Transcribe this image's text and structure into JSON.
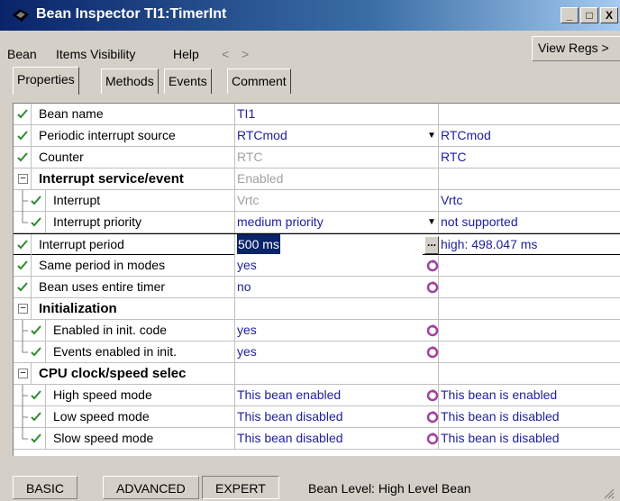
{
  "window": {
    "title": "Bean Inspector TI1:TimerInt",
    "minimize": "_",
    "maximize": "□",
    "close": "X"
  },
  "menu": {
    "items": [
      "Bean",
      "Items Visibility",
      "Help"
    ],
    "back": "<",
    "forward": ">",
    "view_regs": "View Regs >"
  },
  "tabs": [
    {
      "label": "Properties",
      "active": true
    },
    {
      "label": "Methods",
      "active": false
    },
    {
      "label": "Events",
      "active": false
    },
    {
      "label": "Comment",
      "active": false
    }
  ],
  "properties": [
    {
      "name": "Bean name",
      "value": "TI1",
      "info": ""
    },
    {
      "name": "Periodic interrupt source",
      "value": "RTCmod",
      "info": "RTCmod"
    },
    {
      "name": "Counter",
      "value": "RTC",
      "info": "RTC"
    },
    {
      "name": "Interrupt service/event",
      "value": "Enabled",
      "info": "",
      "expander": "−"
    },
    {
      "name": "Interrupt",
      "value": "Vrtc",
      "info": "Vrtc"
    },
    {
      "name": "Interrupt priority",
      "value": "medium priority",
      "info": "not supported"
    },
    {
      "name": "Interrupt period",
      "value": "500 ms",
      "info": "high: 498.047 ms",
      "ellipsis": "..."
    },
    {
      "name": "Same period in modes",
      "value": "yes",
      "info": ""
    },
    {
      "name": "Bean uses entire timer",
      "value": "no",
      "info": ""
    },
    {
      "name": "Initialization",
      "value": "",
      "info": "",
      "expander": "−"
    },
    {
      "name": "Enabled in init. code",
      "value": "yes",
      "info": ""
    },
    {
      "name": "Events enabled in init.",
      "value": "yes",
      "info": ""
    },
    {
      "name": "CPU clock/speed selec",
      "value": "",
      "info": "",
      "expander": "−"
    },
    {
      "name": "High speed mode",
      "value": "This bean enabled",
      "info": "This bean is enabled"
    },
    {
      "name": "Low speed mode",
      "value": "This bean disabled",
      "info": "This bean is disabled"
    },
    {
      "name": "Slow speed mode",
      "value": "This bean disabled",
      "info": "This bean is disabled"
    }
  ],
  "status": {
    "basic": "BASIC",
    "advanced": "ADVANCED",
    "expert": "EXPERT",
    "level": "Bean Level: High Level Bean"
  },
  "colors": {
    "value_text": "#2020a0",
    "check": "#2e8b2e",
    "revert": "#a040a0",
    "title_start": "#0a246a"
  }
}
